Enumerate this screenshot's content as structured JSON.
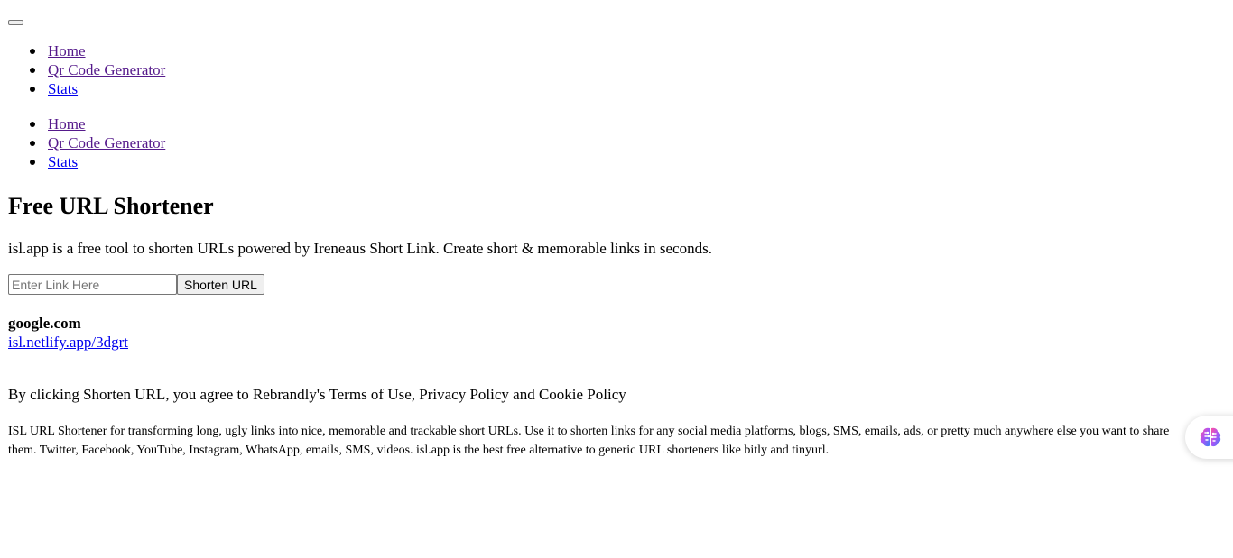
{
  "menu_toggle": {
    "label": ""
  },
  "nav_primary": {
    "items": [
      {
        "label": "Home",
        "icon": "bullet-icon"
      },
      {
        "label": "Qr Code Generator",
        "icon": "bullet-icon"
      },
      {
        "label": "Stats",
        "icon": "bullet-icon"
      }
    ]
  },
  "nav_secondary": {
    "items": [
      {
        "label": "Home",
        "icon": "bullet-icon"
      },
      {
        "label": "Qr Code Generator",
        "icon": "bullet-icon"
      },
      {
        "label": "Stats",
        "icon": "bullet-icon"
      }
    ]
  },
  "hero": {
    "title": "Free URL Shortener",
    "intro": "isl.app is a free tool to shorten URLs powered by Ireneaus Short Link. Create short & memorable links in seconds."
  },
  "form": {
    "input_value": "",
    "input_placeholder": "Enter Link Here",
    "button_label": "Shorten URL"
  },
  "result": {
    "original": "google.com",
    "short": "isl.netlify.app/3dgrt"
  },
  "legal": {
    "terms": "By clicking Shorten URL, you agree to Rebrandly's Terms of Use, Privacy Policy and Cookie Policy"
  },
  "description": "ISL URL Shortener for transforming long, ugly links into nice, memorable and trackable short URLs. Use it to shorten links for any social media platforms, blogs, SMS, emails, ads, or pretty much anywhere else you want to share them. Twitter, Facebook, YouTube, Instagram, WhatsApp, emails, SMS, videos. isl.app is the best free alternative to generic URL shorteners like bitly and tinyurl.",
  "widget": {
    "icon": "brain-icon"
  },
  "colors": {
    "link": "#0000ee",
    "visited_link": "#551a8b",
    "text": "#000000",
    "background": "#ffffff"
  }
}
